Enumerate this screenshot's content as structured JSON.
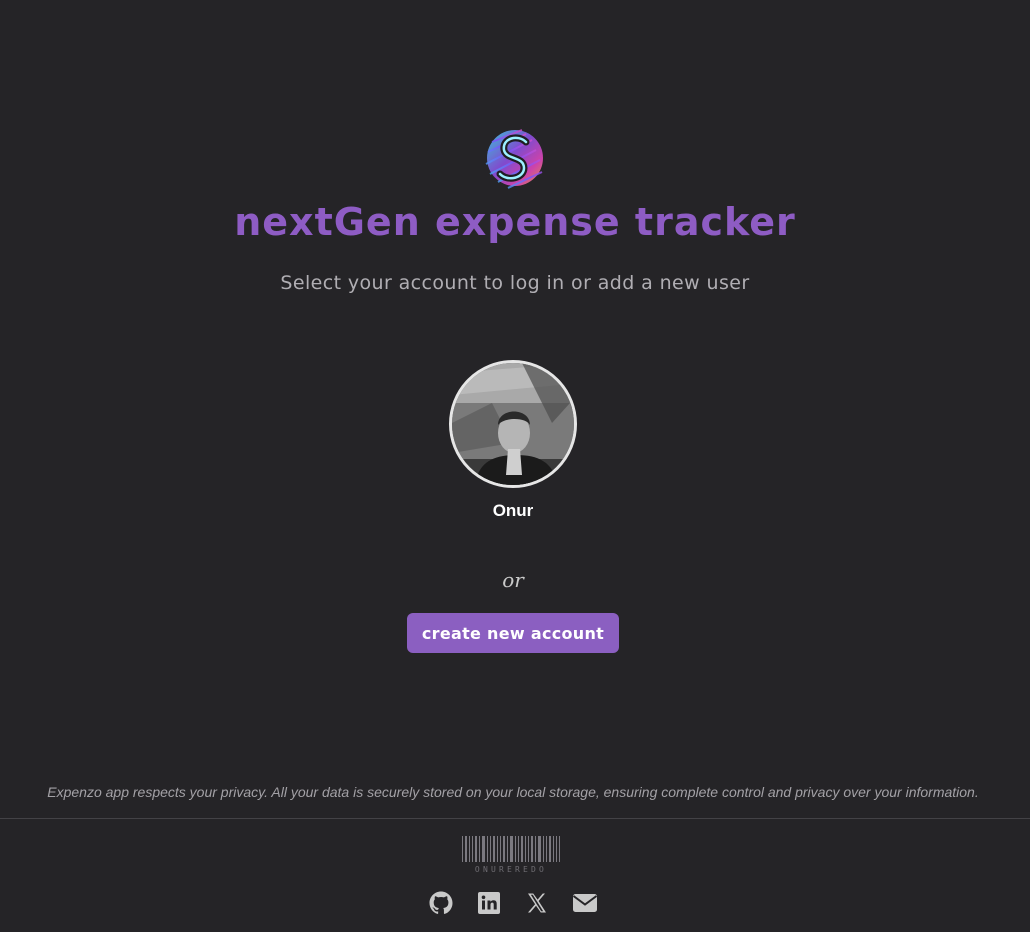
{
  "app": {
    "title": "nextGen expense tracker",
    "subtitle": "Select your account to log in or add a new user"
  },
  "accounts": [
    {
      "name": "Onur"
    }
  ],
  "divider_text": "or",
  "create_button_label": "create new account",
  "footer": {
    "privacy_text": "Expenzo app respects your privacy. All your data is securely stored on your local storage, ensuring complete control and privacy over your information.",
    "signature": "ONUREREDO",
    "social_icons": [
      "github-icon",
      "linkedin-icon",
      "x-icon",
      "email-icon"
    ]
  },
  "colors": {
    "background": "#252427",
    "accent": "#8b5fc1",
    "title": "#8e5cc4"
  }
}
